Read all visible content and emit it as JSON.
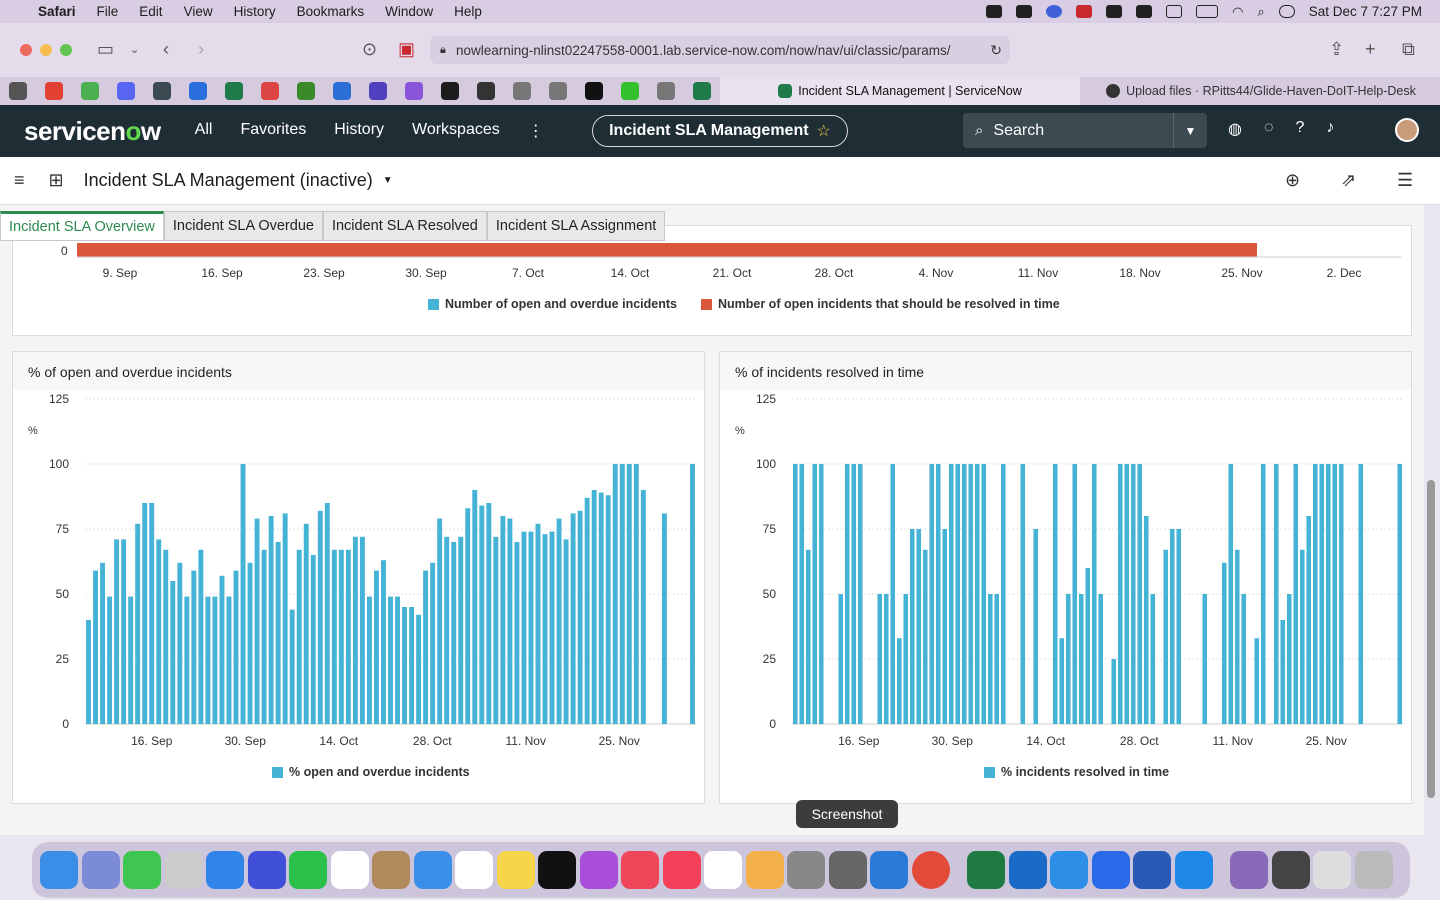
{
  "menubar": {
    "app": "Safari",
    "items": [
      "File",
      "Edit",
      "View",
      "History",
      "Bookmarks",
      "Window",
      "Help"
    ],
    "datetime": "Sat Dec 7  7:27 PM"
  },
  "browser": {
    "url": "nowlearning-nlinst02247558-0001.lab.service-now.com/now/nav/ui/classic/params/",
    "tabs": [
      {
        "label": "Incident SLA Management | ServiceNow"
      },
      {
        "label": "Upload files · RPitts44/Glide-Haven-DoIT-Help-Desk"
      }
    ]
  },
  "sn": {
    "logo_a": "servicen",
    "logo_o": "o",
    "logo_b": "w",
    "nav": [
      "All",
      "Favorites",
      "History",
      "Workspaces"
    ],
    "pill": "Incident SLA Management",
    "search_placeholder": "Search"
  },
  "page": {
    "title": "Incident SLA Management (inactive)"
  },
  "dash_tabs": [
    "Incident SLA Overview",
    "Incident SLA Overdue",
    "Incident SLA Resolved",
    "Incident SLA Assignment"
  ],
  "top_chart": {
    "y_tick": "0",
    "x_labels": [
      "9. Sep",
      "16. Sep",
      "23. Sep",
      "30. Sep",
      "7. Oct",
      "14. Oct",
      "21. Oct",
      "28. Oct",
      "4. Nov",
      "11. Nov",
      "18. Nov",
      "25. Nov",
      "2. Dec"
    ],
    "legend": [
      {
        "label": "Number of open and overdue incidents",
        "color": "#45b3d6"
      },
      {
        "label": "Number of open incidents that should be resolved in time",
        "color": "#d9583b"
      }
    ]
  },
  "chart_data": [
    {
      "type": "bar",
      "title": "% of open and overdue incidents",
      "ylabel": "%",
      "ylim": [
        0,
        125
      ],
      "yticks": [
        0,
        25,
        50,
        75,
        100,
        125
      ],
      "xticklabels": [
        "16. Sep",
        "30. Sep",
        "14. Oct",
        "28. Oct",
        "11. Nov",
        "25. Nov"
      ],
      "series": [
        {
          "name": "% open and overdue incidents",
          "color": "#45b3d6",
          "values": [
            40,
            59,
            62,
            49,
            71,
            71,
            49,
            77,
            85,
            85,
            71,
            67,
            55,
            62,
            49,
            59,
            67,
            49,
            49,
            57,
            49,
            59,
            100,
            62,
            79,
            67,
            80,
            70,
            81,
            44,
            67,
            77,
            65,
            82,
            85,
            67,
            67,
            67,
            72,
            72,
            49,
            59,
            63,
            49,
            49,
            45,
            45,
            42,
            59,
            62,
            79,
            72,
            70,
            72,
            83,
            90,
            84,
            85,
            72,
            80,
            79,
            70,
            74,
            74,
            77,
            73,
            74,
            79,
            71,
            81,
            82,
            87,
            90,
            89,
            88,
            100,
            100,
            100,
            100,
            90,
            0,
            0,
            81,
            0,
            0,
            0,
            100
          ]
        }
      ]
    },
    {
      "type": "bar",
      "title": "% of incidents resolved in time",
      "ylabel": "%",
      "ylim": [
        0,
        125
      ],
      "yticks": [
        0,
        25,
        50,
        75,
        100,
        125
      ],
      "xticklabels": [
        "16. Sep",
        "30. Sep",
        "14. Oct",
        "28. Oct",
        "11. Nov",
        "25. Nov"
      ],
      "series": [
        {
          "name": "% incidents resolved in time",
          "color": "#45b3d6",
          "values": [
            100,
            100,
            67,
            100,
            100,
            0,
            0,
            50,
            100,
            100,
            100,
            0,
            0,
            50,
            50,
            100,
            33,
            50,
            75,
            75,
            67,
            100,
            100,
            75,
            100,
            100,
            100,
            100,
            100,
            100,
            50,
            50,
            100,
            0,
            0,
            100,
            0,
            75,
            0,
            0,
            100,
            33,
            50,
            100,
            50,
            60,
            100,
            50,
            0,
            25,
            100,
            100,
            100,
            100,
            80,
            50,
            0,
            67,
            75,
            75,
            0,
            0,
            0,
            50,
            0,
            0,
            62,
            100,
            67,
            50,
            0,
            33,
            100,
            0,
            100,
            40,
            50,
            100,
            67,
            80,
            100,
            100,
            100,
            100,
            100,
            0,
            0,
            100,
            0,
            0,
            0,
            0,
            0,
            100
          ]
        }
      ]
    }
  ],
  "tooltip": "Screenshot"
}
